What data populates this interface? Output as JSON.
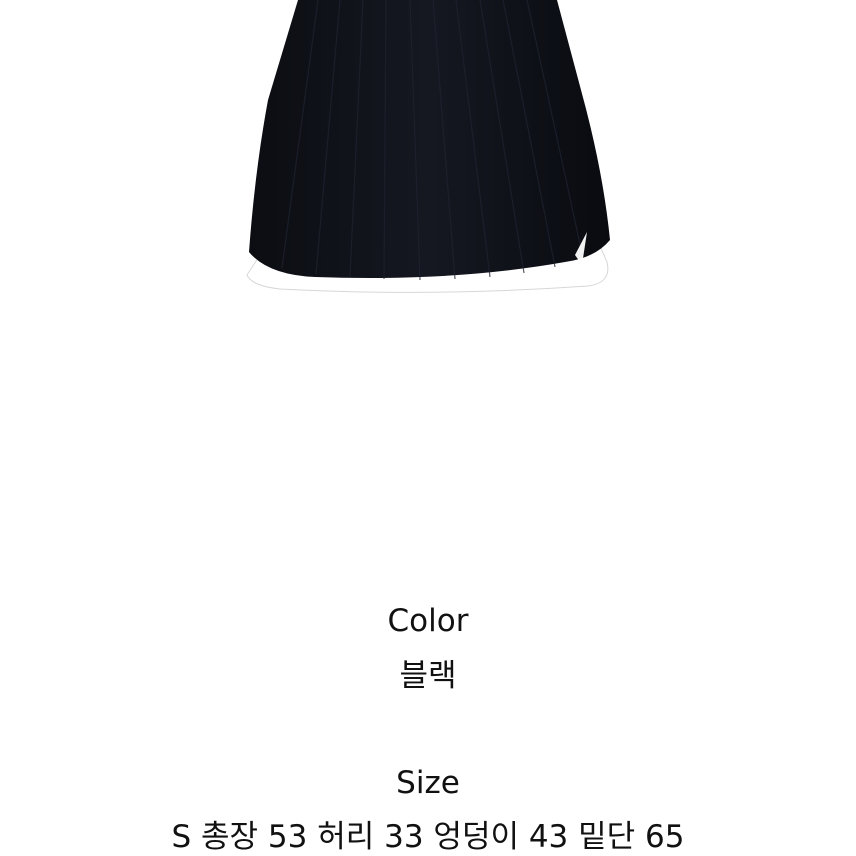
{
  "product": {
    "image_description_icon": "black-pleated-skirt-image",
    "skirt_color": "#0d0f14",
    "lining_color": "#ffffff"
  },
  "details": {
    "color_heading": "Color",
    "color_value": "블랙",
    "size_heading": "Size",
    "size_value": "S 총장 53 허리 33 엉덩이 43 밑단 65"
  }
}
